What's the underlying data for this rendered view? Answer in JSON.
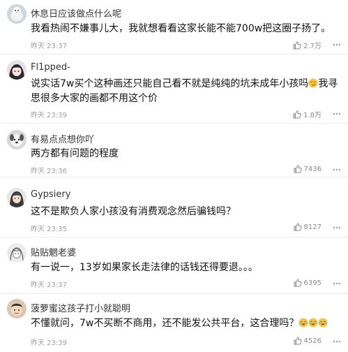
{
  "comments": [
    {
      "name": "休息日应该做点什么呢",
      "text": "我看热闹不嫌事儿大，我就想看看这家长能不能700w把这圈子扬了。",
      "time": "昨天 23:37",
      "likes": "2.7万",
      "avatar_icon": "bird-avatar"
    },
    {
      "name": "Fl1pped-",
      "text": "说实话7w买个这种画还只能自己看不就是纯纯的坑未成年小孩吗",
      "text_tail": "我寻思很多大家的画都不用这个价",
      "emoji_icon": "smirk-emoji",
      "time": "昨天 23:39",
      "likes": "1.8万",
      "avatar_icon": "anime-avatar"
    },
    {
      "name": "有易点点想你吖",
      "text": "两方都有问题的程度",
      "time": "昨天 23:36",
      "likes": "7436",
      "avatar_icon": "dog-avatar"
    },
    {
      "name": "Gypsiery",
      "text": "这不是欺负人家小孩没有消费观念然后骗钱吗？",
      "time": "昨天 23:35",
      "likes": "8127",
      "avatar_icon": "girl-avatar"
    },
    {
      "name": "贴贴魍老婆",
      "text": "有一说一，13岁如果家长走法律的话钱还得要退。。。",
      "time": "昨天 23:37",
      "likes": "6395",
      "avatar_icon": "sketch-avatar"
    },
    {
      "name": "菠萝蜜这孩子打小就聪明",
      "text": "不懂就问，7w不买断不商用，还不能发公共平台，这合理吗？",
      "emoji_icon": "laugh-cry-emoji",
      "time": "昨天 23:39",
      "likes": "4526",
      "avatar_icon": "kid-avatar"
    }
  ]
}
